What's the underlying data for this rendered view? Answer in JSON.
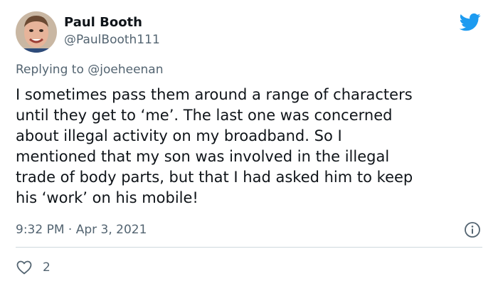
{
  "tweet": {
    "author": {
      "display_name": "Paul Booth",
      "handle": "@PaulBooth111",
      "avatar_icon": "person-face-avatar"
    },
    "brand_icon": "twitter-bird-icon",
    "brand_color": "#1d9bf0",
    "replying_prefix": "Replying to",
    "replying_to": "@joeheenan",
    "body_lines": [
      "I sometimes pass them around a range of characters",
      "until they get to ‘me’. The last one was concerned",
      "about illegal activity on my broadband. So I",
      "mentioned that my son was involved in the illegal",
      "trade of body parts, but that I had asked him to keep",
      "his ‘work’ on his mobile!"
    ],
    "time": "9:32 PM",
    "separator": "·",
    "date": "Apr 3, 2021",
    "info_icon": "info-icon",
    "like_icon": "heart-icon",
    "like_count": "2",
    "text_color": "#0f1419",
    "muted_color": "#536471"
  }
}
